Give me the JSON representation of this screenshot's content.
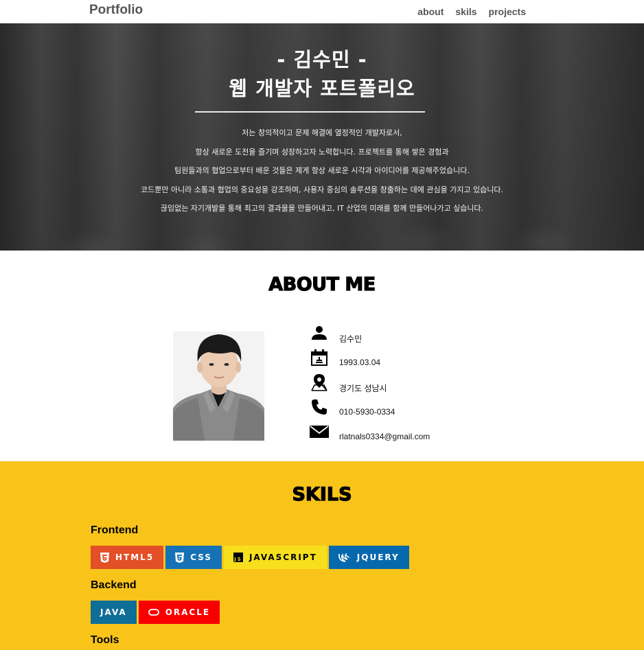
{
  "nav": {
    "brand": "Portfolio",
    "links": [
      "about",
      "skils",
      "projects"
    ]
  },
  "hero": {
    "name": "- 김수민 -",
    "title": "웹 개발자 포트폴리오",
    "description": [
      "저는 창의적이고 문제 해결에 열정적인 개발자로서,",
      "항상 새로운 도전을 즐기며 성장하고자 노력합니다. 프로젝트를 통해 쌓은 경험과",
      "팀원들과의 협업으로부터 배운 것들은 제게 항상 새로운 시각과 아이디어를 제공해주었습니다.",
      "코드뿐만 아니라 소통과 협업의 중요성을 강조하며, 사용자 중심의 솔루션을 창출하는 데에 관심을 가지고 있습니다.",
      "끊임없는 자기개발을 통해 최고의 결과물을 만들어내고, IT 산업의 미래를 함께 만들어나가고 싶습니다."
    ]
  },
  "about": {
    "heading": "ABOUT ME",
    "info": [
      {
        "icon": "person-icon",
        "text": "김수민"
      },
      {
        "icon": "calendar-icon",
        "text": "1993.03.04"
      },
      {
        "icon": "location-icon",
        "text": "경기도 성남시"
      },
      {
        "icon": "phone-icon",
        "text": "010-5930-0334"
      },
      {
        "icon": "mail-icon",
        "text": "rlatnals0334@gmail.com"
      }
    ]
  },
  "skils": {
    "heading": "SKILS",
    "groups": [
      {
        "title": "Frontend",
        "badges": [
          {
            "label": "HTML5",
            "icon": "html5-icon",
            "bg": "#e34f26",
            "fg": "#ffffff"
          },
          {
            "label": "CSS",
            "icon": "css3-icon",
            "bg": "#1572b6",
            "fg": "#ffffff"
          },
          {
            "label": "JAVASCRIPT",
            "icon": "javascript-icon",
            "bg": "#f7df1e",
            "fg": "#000000"
          },
          {
            "label": "JQUERY",
            "icon": "jquery-icon",
            "bg": "#0769ad",
            "fg": "#ffffff"
          }
        ]
      },
      {
        "title": "Backend",
        "badges": [
          {
            "label": "JAVA",
            "icon": "",
            "bg": "#0f6e98",
            "fg": "#ffffff"
          },
          {
            "label": "ORACLE",
            "icon": "oracle-icon",
            "bg": "#f80000",
            "fg": "#ffffff"
          }
        ]
      },
      {
        "title": "Tools",
        "badges": []
      }
    ]
  },
  "colors": {
    "skils_background": "#f8c41a",
    "hero_overlay": "#3c3c3c",
    "nav_text": "#555555"
  }
}
